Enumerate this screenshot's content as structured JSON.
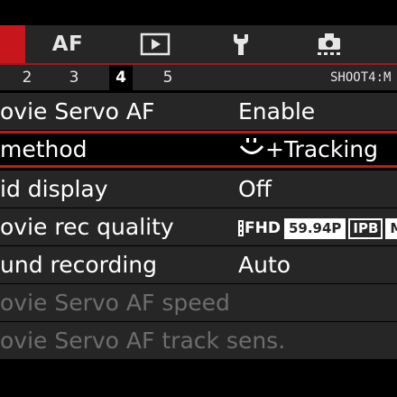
{
  "tabs": {
    "af_label": "AF",
    "icons": [
      "camera-shoot-tab",
      "play-icon",
      "wrench-icon",
      "mymenu-icon"
    ]
  },
  "subtabs": {
    "numbers": [
      "2",
      "3",
      "4",
      "5"
    ],
    "active": "4",
    "screen_label": "SHOOT4:M"
  },
  "rows": [
    {
      "label": "ovie Servo AF",
      "value": "Enable"
    },
    {
      "label": " method",
      "value": "+Tracking"
    },
    {
      "label": "id display",
      "value": "Off"
    },
    {
      "label": "ovie rec quality",
      "value": {
        "size": "FHD",
        "rate": "59.94P",
        "compression": "IPB",
        "extra": "M"
      }
    },
    {
      "label": "und recording",
      "value": "Auto"
    },
    {
      "label": "ovie Servo AF speed",
      "value": ""
    },
    {
      "label": "ovie Servo AF track sens.",
      "value": ""
    }
  ],
  "colors": {
    "accent_red": "#c8171c",
    "bar_gray": "#262626",
    "dim_text": "#6d6d6d"
  }
}
